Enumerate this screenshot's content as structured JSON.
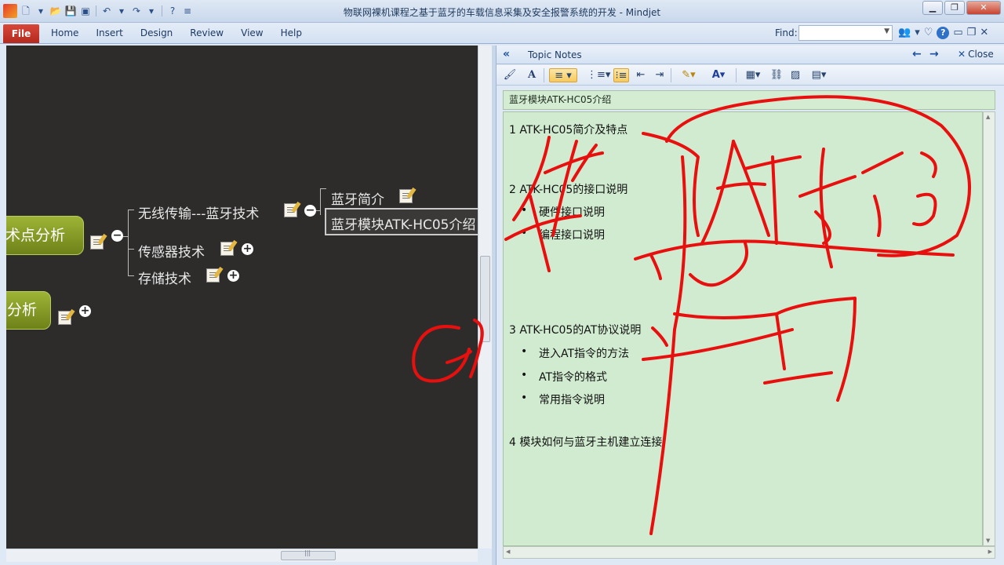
{
  "window": {
    "title": "物联网裸机课程之基于蓝牙的车载信息采集及安全报警系统的开发  - Mindjet"
  },
  "ribbon": {
    "file_label": "File",
    "tabs": [
      "Home",
      "Insert",
      "Design",
      "Review",
      "View",
      "Help"
    ],
    "find_label": "Find:"
  },
  "map": {
    "main_topic": "术点分析",
    "secondary_topic": "分析",
    "subtopics": [
      "无线传输---蓝牙技术",
      "传感器技术",
      "存储技术"
    ],
    "sub_subtopics": [
      "蓝牙简介",
      "蓝牙模块ATK-HC05介绍"
    ]
  },
  "notes": {
    "header_label": "Topic Notes",
    "close_label": "Close",
    "title": "蓝牙模块ATK-HC05介绍",
    "sections": [
      {
        "heading": "1  ATK-HC05简介及特点",
        "bullets": []
      },
      {
        "heading": "2  ATK-HC05的接口说明",
        "bullets": [
          "硬件接口说明",
          "编程接口说明"
        ]
      },
      {
        "heading": "3  ATK-HC05的AT协议说明",
        "bullets": [
          "进入AT指令的方法",
          "AT指令的格式",
          "常用指令说明"
        ]
      },
      {
        "heading": "4  模块如何与蓝牙主机建立连接",
        "bullets": []
      }
    ]
  },
  "colors": {
    "ink": "#e8100f",
    "topic_green": "#8aa028",
    "canvas": "#2d2c2b",
    "notes_bg": "#d0ebcf"
  }
}
